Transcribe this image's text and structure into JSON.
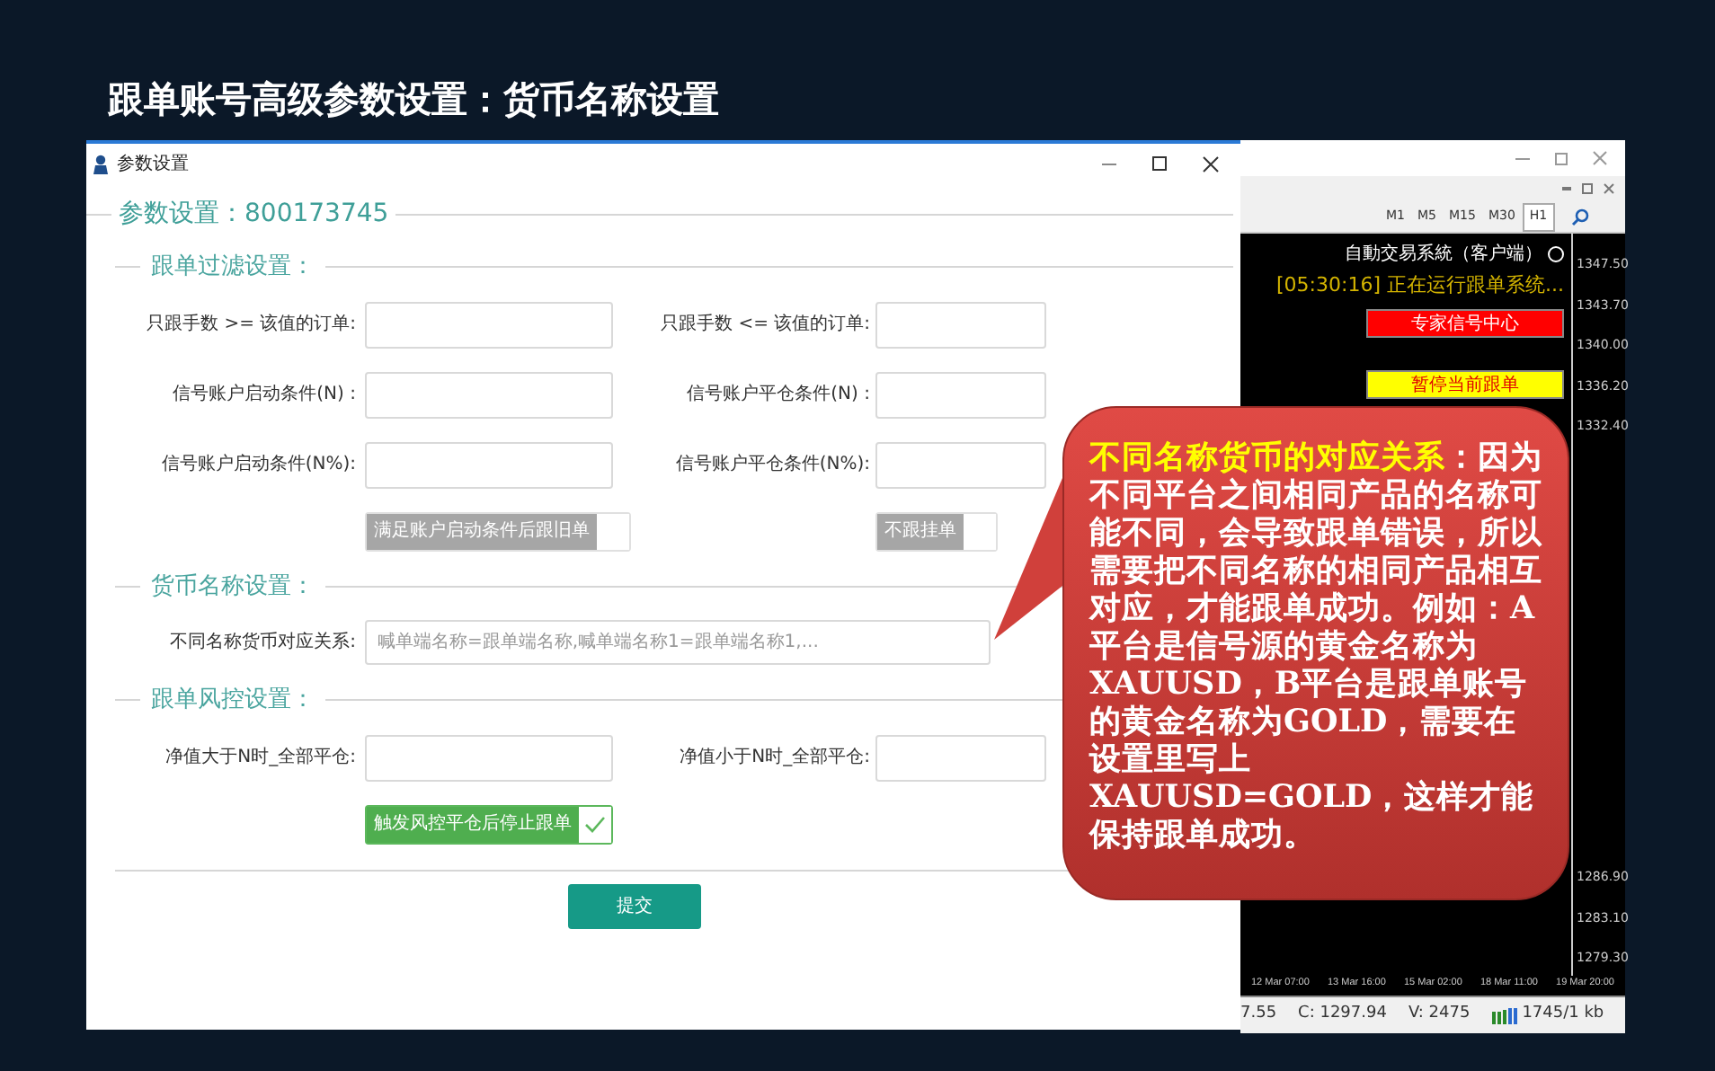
{
  "slide_title": "跟单账号高级参数设置：货币名称设置",
  "terminal": {
    "toolbar": [
      {
        "label": "M1",
        "selected": false
      },
      {
        "label": "M5",
        "selected": false
      },
      {
        "label": "M15",
        "selected": false
      },
      {
        "label": "M30",
        "selected": false
      },
      {
        "label": "H1",
        "selected": true
      }
    ],
    "panel_title": "自動交易系統（客户端）",
    "running_text": "[05:30:16] 正在运行跟单系统...",
    "buttons": [
      {
        "label": "专家信号中心",
        "color": "#ff0000"
      },
      {
        "label": "暂停当前跟单",
        "color": "#ffff00"
      }
    ],
    "price_labels": [
      "1347.50",
      "1343.70",
      "1340.00",
      "1336.20",
      "1332.40",
      "1286.90",
      "1283.10",
      "1279.30"
    ],
    "time_labels": [
      "12 Mar 07:00",
      "13 Mar 16:00",
      "15 Mar 02:00",
      "18 Mar 11:00",
      "19 Mar 20:00"
    ],
    "status_bar": [
      "7.55",
      "C: 1297.94",
      "V: 2475",
      "1745/1 kb"
    ]
  },
  "dialog": {
    "title": "参数设置",
    "legend": "参数设置：800173745",
    "sections": [
      {
        "title": "跟单过滤设置：",
        "rows": [
          {
            "kind": "fields",
            "fields": [
              {
                "label": "只跟手数 >= 该值的订单:"
              },
              {
                "label": "只跟手数 <= 该值的订单:"
              }
            ]
          },
          {
            "kind": "fields",
            "fields": [
              {
                "label": "信号账户启动条件(N)  :"
              },
              {
                "label": "信号账户平仓条件(N)  :"
              }
            ]
          },
          {
            "kind": "fields",
            "fields": [
              {
                "label": "信号账户启动条件(N%):"
              },
              {
                "label": "信号账户平仓条件(N%):"
              }
            ]
          },
          {
            "kind": "toggles",
            "toggles": [
              {
                "label": "满足账户启动条件后跟旧单",
                "checked": false
              },
              {
                "label": "不跟挂单",
                "checked": false
              }
            ]
          }
        ]
      },
      {
        "title": "货币名称设置：",
        "rows": [
          {
            "kind": "wide",
            "label": "不同名称货币对应关系:",
            "placeholder": "喊单端名称=跟单端名称,喊单端名称1=跟单端名称1,..."
          }
        ]
      },
      {
        "title": "跟单风控设置：",
        "rows": [
          {
            "kind": "fields",
            "fields": [
              {
                "label": "净值大于N时_全部平仓:"
              },
              {
                "label": "净值小于N时_全部平仓:"
              }
            ]
          },
          {
            "kind": "toggles",
            "toggles": [
              {
                "label": "触发风控平仓后停止跟单",
                "checked": true
              }
            ]
          }
        ]
      }
    ],
    "submit": "提交"
  },
  "callout": {
    "highlight": "不同名称货币的对应关系",
    "text": "：因为不同平台之间相同产品的名称可能不同，会导致跟单错误，所以需要把不同名称的相同产品相互对应，才能跟单成功。例如：A平台是信号源的黄金名称为XAUUSD，B平台是跟单账号的黄金名称为GOLD，需要在设置里写上XAUUSD=GOLD，这样才能保持跟单成功。"
  }
}
